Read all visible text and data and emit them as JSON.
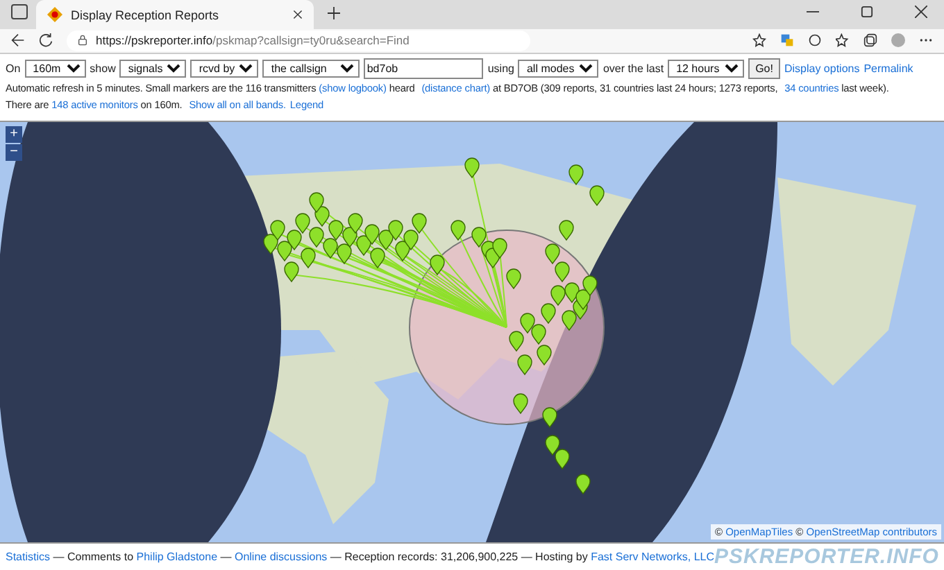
{
  "browser": {
    "tab_title": "Display Reception Reports",
    "url_host": "https://pskreporter.info",
    "url_path": "/pskmap?callsign=ty0ru&search=Find"
  },
  "controls": {
    "on_label": "On",
    "band": "160m",
    "show_label": "show",
    "what": "signals",
    "direction": "rcvd by",
    "target": "the callsign",
    "callsign": "bd7ob",
    "using_label": "using",
    "mode": "all modes",
    "over_label": "over the last",
    "period": "12 hours",
    "go": "Go!",
    "links": [
      "Display options",
      "Permalink"
    ]
  },
  "info_lines": [
    [
      {
        "kind": "text",
        "text": "Automatic refresh in 5 minutes. Small markers are the 116 transmitters "
      },
      {
        "kind": "link",
        "text": "(show logbook)"
      },
      {
        "kind": "text",
        "text": " heard "
      },
      {
        "kind": "link",
        "text": "(distance chart)"
      },
      {
        "kind": "text",
        "text": " at BD7OB (309 reports, 31 countries last 24 hours; 1273 reports, "
      },
      {
        "kind": "link",
        "text": "34 countries"
      },
      {
        "kind": "text",
        "text": " last week)."
      }
    ],
    [
      {
        "kind": "text",
        "text": "There are "
      },
      {
        "kind": "link",
        "text": "148 active monitors"
      },
      {
        "kind": "text",
        "text": " on 160m. "
      },
      {
        "kind": "link",
        "text": "Show all on all bands."
      },
      {
        "kind": "link",
        "text": "Legend"
      }
    ]
  ],
  "map": {
    "zoom_in": "+",
    "zoom_out": "−",
    "attribution": [
      {
        "kind": "text",
        "text": "© "
      },
      {
        "kind": "link",
        "text": "OpenMapTiles"
      },
      {
        "kind": "text",
        "text": " © "
      },
      {
        "kind": "link",
        "text": "OpenStreetMap contributors"
      }
    ]
  },
  "footer": {
    "segments": [
      {
        "kind": "link",
        "text": "Statistics"
      },
      {
        "kind": "text",
        "text": " — Comments to "
      },
      {
        "kind": "link",
        "text": "Philip Gladstone"
      },
      {
        "kind": "text",
        "text": " — "
      },
      {
        "kind": "link",
        "text": "Online discussions"
      },
      {
        "kind": "text",
        "text": " — Reception records: 31,206,900,225 — Hosting by "
      },
      {
        "kind": "link",
        "text": "Fast Serv Networks, LLC"
      }
    ],
    "logo": "PSKREPORTER.INFO"
  }
}
